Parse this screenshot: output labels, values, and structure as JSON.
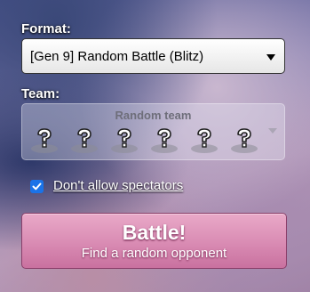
{
  "format": {
    "label": "Format:",
    "selected": "[Gen 9] Random Battle (Blitz)"
  },
  "team": {
    "label": "Team:",
    "title": "Random team",
    "slots": [
      "question-mark-pokemon-icon",
      "question-mark-pokemon-icon",
      "question-mark-pokemon-icon",
      "question-mark-pokemon-icon",
      "question-mark-pokemon-icon",
      "question-mark-pokemon-icon"
    ]
  },
  "spectators": {
    "label": "Don't allow spectators",
    "checked": true
  },
  "battle_button": {
    "main": "Battle!",
    "sub": "Find a random opponent"
  },
  "colors": {
    "checkbox": "#1a73e8",
    "battle_button": "#d98bb3"
  }
}
